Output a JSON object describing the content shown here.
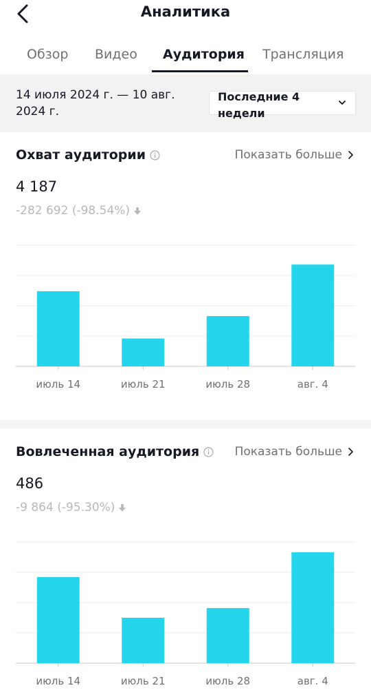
{
  "header": {
    "title": "Аналитика",
    "back_icon": "chevron-left-icon"
  },
  "tabs": [
    {
      "label": "Обзор",
      "active": false
    },
    {
      "label": "Видео",
      "active": false
    },
    {
      "label": "Аудитория",
      "active": true
    },
    {
      "label": "Трансляция",
      "active": false
    }
  ],
  "date_filter": {
    "range": "14 июля 2024 г. — 10 авг. 2024 г.",
    "period_label": "Последние 4 недели",
    "dropdown_icon": "chevron-down-icon"
  },
  "reach": {
    "title": "Охват аудитории",
    "info_icon": "info-icon",
    "show_more": "Показать больше",
    "value": "4 187",
    "delta": "-282 692 (-98.54%)",
    "delta_icon": "down-arrow-icon"
  },
  "engaged": {
    "title": "Вовлеченная аудитория",
    "info_icon": "info-icon",
    "show_more": "Показать больше",
    "value": "486",
    "delta": "-9 864 (-95.30%)",
    "delta_icon": "down-arrow-icon"
  },
  "chart_data": [
    {
      "type": "bar",
      "categories": [
        "июль 14",
        "июль 21",
        "июль 28",
        "авг. 4"
      ],
      "values": [
        1240,
        460,
        830,
        1680
      ],
      "ylim": [
        0,
        2000
      ],
      "grid": true,
      "color": "#25d5ec"
    },
    {
      "type": "bar",
      "categories": [
        "июль 14",
        "июль 21",
        "июль 28",
        "авг. 4"
      ],
      "values": [
        142,
        75,
        91,
        183
      ],
      "ylim": [
        0,
        200
      ],
      "grid": true,
      "color": "#25d5ec"
    }
  ]
}
